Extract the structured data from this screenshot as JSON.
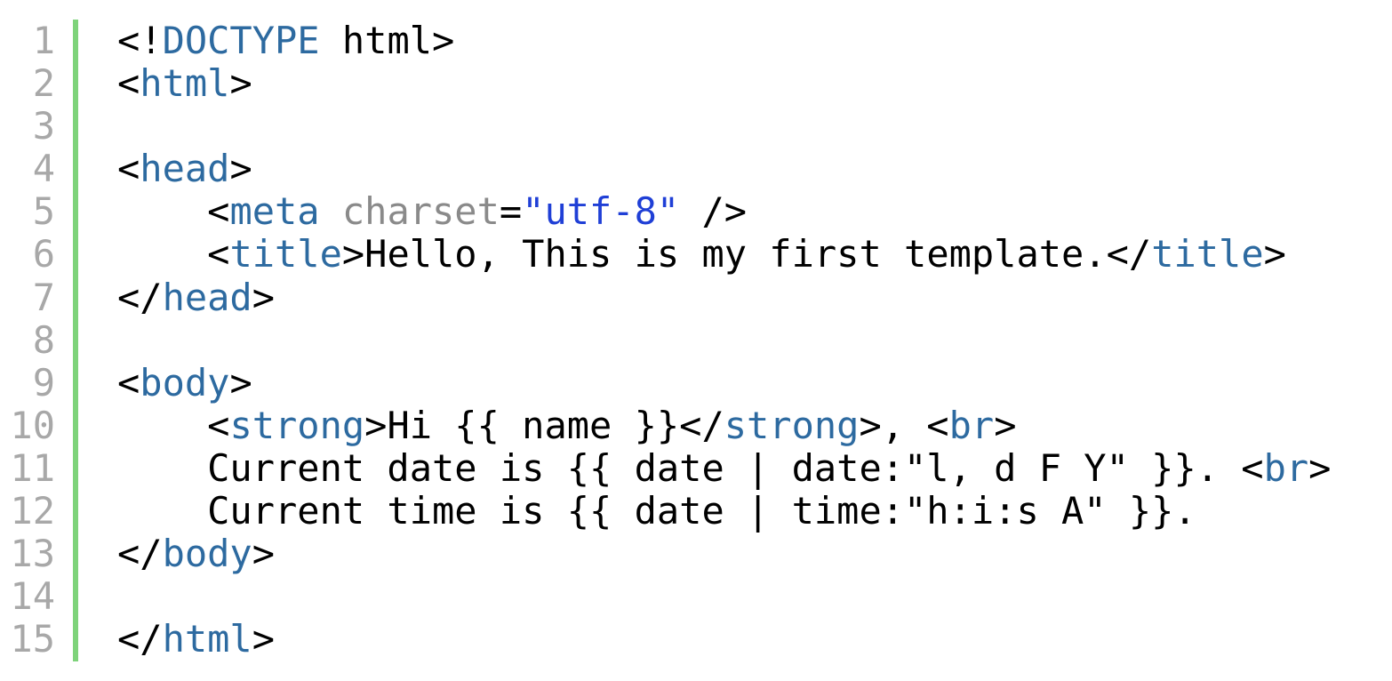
{
  "colors": {
    "gutter_bar": "#7ed37a",
    "line_number": "#a8a8a8",
    "tag": "#2d6aa0",
    "attribute": "#8a8a8a",
    "string": "#1f3fd6",
    "text": "#000000"
  },
  "lines": [
    {
      "num": "1",
      "tokens": [
        {
          "t": "<!",
          "c": "punc"
        },
        {
          "t": "DOCTYPE",
          "c": "tag"
        },
        {
          "t": " html>",
          "c": "punc"
        }
      ]
    },
    {
      "num": "2",
      "tokens": [
        {
          "t": "<",
          "c": "punc"
        },
        {
          "t": "html",
          "c": "tag"
        },
        {
          "t": ">",
          "c": "punc"
        }
      ]
    },
    {
      "num": "3",
      "tokens": []
    },
    {
      "num": "4",
      "tokens": [
        {
          "t": "<",
          "c": "punc"
        },
        {
          "t": "head",
          "c": "tag"
        },
        {
          "t": ">",
          "c": "punc"
        }
      ]
    },
    {
      "num": "5",
      "tokens": [
        {
          "t": "    <",
          "c": "punc"
        },
        {
          "t": "meta",
          "c": "tag"
        },
        {
          "t": " charset",
          "c": "attr"
        },
        {
          "t": "=",
          "c": "punc"
        },
        {
          "t": "\"utf-8\"",
          "c": "str"
        },
        {
          "t": " />",
          "c": "punc"
        }
      ]
    },
    {
      "num": "6",
      "tokens": [
        {
          "t": "    <",
          "c": "punc"
        },
        {
          "t": "title",
          "c": "tag"
        },
        {
          "t": ">Hello, This is my first template.</",
          "c": "punc"
        },
        {
          "t": "title",
          "c": "tag"
        },
        {
          "t": ">",
          "c": "punc"
        }
      ]
    },
    {
      "num": "7",
      "tokens": [
        {
          "t": "</",
          "c": "punc"
        },
        {
          "t": "head",
          "c": "tag"
        },
        {
          "t": ">",
          "c": "punc"
        }
      ]
    },
    {
      "num": "8",
      "tokens": []
    },
    {
      "num": "9",
      "tokens": [
        {
          "t": "<",
          "c": "punc"
        },
        {
          "t": "body",
          "c": "tag"
        },
        {
          "t": ">",
          "c": "punc"
        }
      ]
    },
    {
      "num": "10",
      "tokens": [
        {
          "t": "    <",
          "c": "punc"
        },
        {
          "t": "strong",
          "c": "tag"
        },
        {
          "t": ">Hi {{ name }}</",
          "c": "punc"
        },
        {
          "t": "strong",
          "c": "tag"
        },
        {
          "t": ">, <",
          "c": "punc"
        },
        {
          "t": "br",
          "c": "tag"
        },
        {
          "t": ">",
          "c": "punc"
        }
      ]
    },
    {
      "num": "11",
      "tokens": [
        {
          "t": "    Current date is {{ date | date:\"l, d F Y\" }}. <",
          "c": "punc"
        },
        {
          "t": "br",
          "c": "tag"
        },
        {
          "t": ">",
          "c": "punc"
        }
      ]
    },
    {
      "num": "12",
      "tokens": [
        {
          "t": "    Current time is {{ date | time:\"h:i:s A\" }}.",
          "c": "punc"
        }
      ]
    },
    {
      "num": "13",
      "tokens": [
        {
          "t": "</",
          "c": "punc"
        },
        {
          "t": "body",
          "c": "tag"
        },
        {
          "t": ">",
          "c": "punc"
        }
      ]
    },
    {
      "num": "14",
      "tokens": []
    },
    {
      "num": "15",
      "tokens": [
        {
          "t": "</",
          "c": "punc"
        },
        {
          "t": "html",
          "c": "tag"
        },
        {
          "t": ">",
          "c": "punc"
        }
      ]
    }
  ]
}
